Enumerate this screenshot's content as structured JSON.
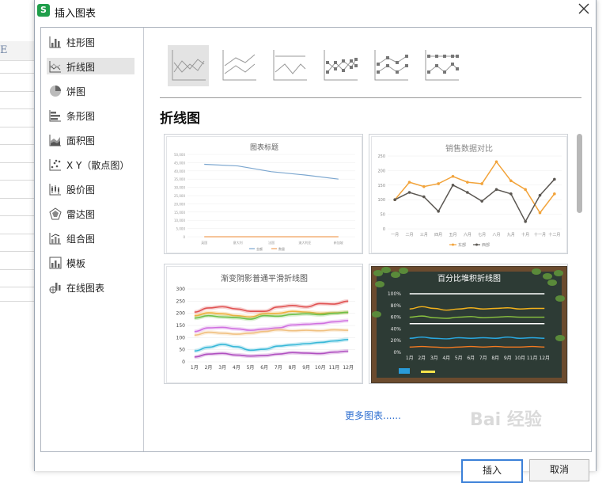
{
  "dialog": {
    "title": "插入图表",
    "app_logo": "S"
  },
  "sheet": {
    "column_letter": "E"
  },
  "sidebar": {
    "items": [
      {
        "label": "柱形图",
        "icon": "column-chart-icon"
      },
      {
        "label": "折线图",
        "icon": "line-chart-icon",
        "selected": true
      },
      {
        "label": "饼图",
        "icon": "pie-chart-icon"
      },
      {
        "label": "条形图",
        "icon": "bar-chart-icon"
      },
      {
        "label": "面积图",
        "icon": "area-chart-icon"
      },
      {
        "label": "X Y（散点图）",
        "icon": "scatter-chart-icon"
      },
      {
        "label": "股价图",
        "icon": "stock-chart-icon"
      },
      {
        "label": "雷达图",
        "icon": "radar-chart-icon"
      },
      {
        "label": "组合图",
        "icon": "combo-chart-icon"
      },
      {
        "label": "模板",
        "icon": "template-icon"
      },
      {
        "label": "在线图表",
        "icon": "online-chart-icon"
      }
    ]
  },
  "main": {
    "section_title": "折线图",
    "more_link": "更多图表......",
    "cards": [
      {
        "title": "图表标题"
      },
      {
        "title": "销售数据对比"
      },
      {
        "title": "渐变阴影普通平滑折线图"
      },
      {
        "title": "百分比堆积折线图"
      }
    ],
    "card_chart_1": {
      "y_ticks": [
        "50,000",
        "45,000",
        "40,000",
        "35,000",
        "30,000",
        "25,000",
        "20,000",
        "15,000",
        "10,000",
        "5,000",
        "0"
      ],
      "x_labels": [
        "英国",
        "意大利",
        "法国",
        "澳大利亚",
        "新加坡"
      ],
      "legend": [
        "金额",
        "数量"
      ],
      "series_amount": [
        44000,
        43000,
        39500,
        37500,
        35000
      ],
      "series_qty": [
        0,
        0,
        0,
        0,
        0
      ],
      "y_max": 50000,
      "colors": [
        "#7ba6cf",
        "#f0a15e"
      ]
    },
    "card_chart_2": {
      "y_ticks": [
        "250",
        "200",
        "150",
        "100",
        "50",
        "0"
      ],
      "x_labels": [
        "一月",
        "二月",
        "三月",
        "四月",
        "五月",
        "六月",
        "七月",
        "八月",
        "九月",
        "十月",
        "十一月",
        "十二月"
      ],
      "legend": [
        "东部",
        "西部"
      ],
      "series_a": [
        100,
        160,
        145,
        155,
        180,
        160,
        155,
        230,
        165,
        135,
        55,
        120
      ],
      "series_b": [
        100,
        125,
        110,
        60,
        150,
        125,
        95,
        135,
        120,
        25,
        115,
        170
      ],
      "y_max": 250,
      "colors": [
        "#f2a33a",
        "#5b5752"
      ]
    },
    "card_chart_3": {
      "y_ticks": [
        "300",
        "250",
        "200",
        "150",
        "100",
        "50",
        "0"
      ],
      "x_labels": [
        "1月",
        "2月",
        "3月",
        "4月",
        "5月",
        "6月",
        "7月",
        "8月",
        "9月",
        "10月",
        "11月",
        "12月"
      ],
      "y_max": 300,
      "series": [
        {
          "color": "#e05252",
          "values": [
            205,
            222,
            227,
            218,
            208,
            208,
            226,
            232,
            226,
            240,
            238,
            250
          ]
        },
        {
          "color": "#f0b040",
          "values": [
            190,
            202,
            198,
            190,
            185,
            198,
            200,
            208,
            205,
            200,
            202,
            204
          ]
        },
        {
          "color": "#6cc04a",
          "values": [
            180,
            190,
            185,
            182,
            176,
            190,
            188,
            195,
            198,
            194,
            200,
            204
          ]
        },
        {
          "color": "#d070e0",
          "values": [
            125,
            140,
            142,
            136,
            130,
            135,
            140,
            152,
            155,
            158,
            165,
            170
          ]
        },
        {
          "color": "#f0c080",
          "values": [
            110,
            122,
            118,
            114,
            118,
            125,
            132,
            128,
            130,
            128,
            132,
            130
          ]
        },
        {
          "color": "#38b8d8",
          "values": [
            45,
            60,
            72,
            62,
            48,
            52,
            65,
            70,
            75,
            80,
            86,
            92
          ]
        },
        {
          "color": "#b050c0",
          "values": [
            20,
            32,
            35,
            28,
            24,
            26,
            32,
            38,
            36,
            34,
            40,
            44
          ]
        }
      ]
    },
    "card_chart_4": {
      "y_ticks": [
        "100%",
        "80%",
        "60%",
        "40%",
        "20%",
        "0%"
      ],
      "x_labels": [
        "1月",
        "2月",
        "3月",
        "4月",
        "5月",
        "6月",
        "7月",
        "8月",
        "9月",
        "10月",
        "11月",
        "12月"
      ],
      "y_max": 100,
      "series": [
        {
          "color": "#ffffff",
          "values": [
            100,
            100,
            100,
            100,
            100,
            100,
            100,
            100,
            100,
            100,
            100,
            100
          ]
        },
        {
          "color": "#f3b21c",
          "values": [
            74,
            78,
            75,
            72,
            74,
            76,
            74,
            75,
            76,
            74,
            75,
            75
          ]
        },
        {
          "color": "#8cc63f",
          "values": [
            60,
            62,
            59,
            58,
            60,
            61,
            59,
            60,
            61,
            60,
            60,
            60
          ]
        },
        {
          "color": "#ffffff",
          "values": [
            49,
            49,
            49,
            49,
            49,
            49,
            49,
            49,
            49,
            49,
            49,
            49
          ]
        },
        {
          "color": "#29a8e0",
          "values": [
            24,
            26,
            24,
            23,
            25,
            24,
            25,
            24,
            26,
            24,
            25,
            24
          ]
        },
        {
          "color": "#f47a20",
          "values": [
            9,
            10,
            9,
            8,
            9,
            10,
            9,
            10,
            9,
            9,
            10,
            9
          ]
        }
      ]
    }
  },
  "footer": {
    "insert_label": "插入",
    "cancel_label": "取消"
  },
  "watermark": "Bai 经验"
}
